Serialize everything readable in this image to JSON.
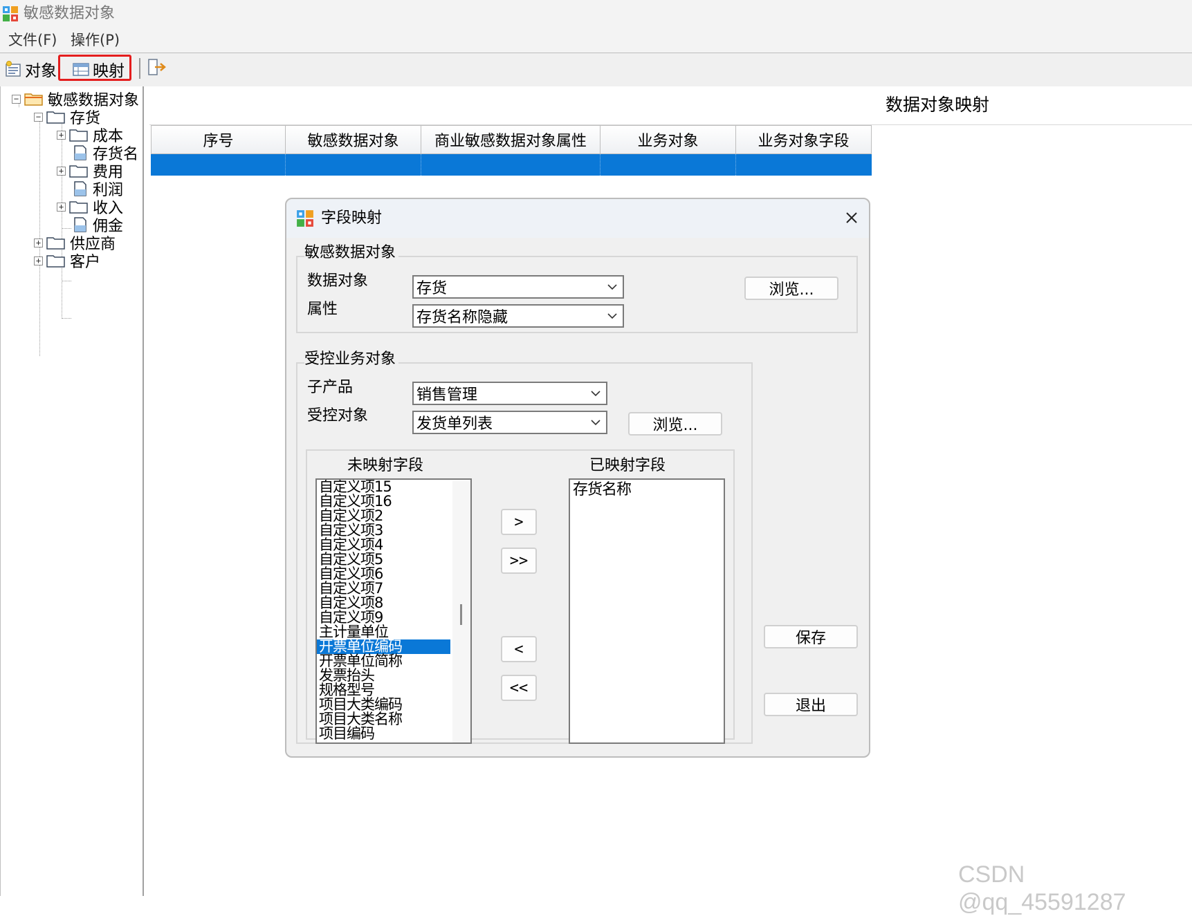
{
  "window": {
    "title": "敏感数据对象"
  },
  "menu": [
    "文件(F)",
    "操作(P)"
  ],
  "toolbar": {
    "object_label": "对象",
    "mapping_label": "映射"
  },
  "tree": {
    "root": "敏感数据对象",
    "inventory": "存货",
    "cost": "成本",
    "inventory_name": "存货名",
    "expense": "费用",
    "profit": "利润",
    "income": "收入",
    "commission": "佣金",
    "supplier": "供应商",
    "customer": "客户"
  },
  "main": {
    "title": "数据对象映射",
    "columns": [
      "序号",
      "敏感数据对象",
      "商业敏感数据对象属性",
      "业务对象",
      "业务对象字段"
    ]
  },
  "dialog": {
    "title": "字段映射",
    "sensitive_group": "敏感数据对象",
    "data_object_label": "数据对象",
    "data_object_value": "存货",
    "attribute_label": "属性",
    "attribute_value": "存货名称隐藏",
    "browse_label": "浏览...",
    "controlled_group": "受控业务对象",
    "sub_product_label": "子产品",
    "sub_product_value": "销售管理",
    "controlled_object_label": "受控对象",
    "controlled_object_value": "发货单列表",
    "unmapped_header": "未映射字段",
    "mapped_header": "已映射字段",
    "unmapped_fields": [
      "自定义项15",
      "自定义项16",
      "自定义项2",
      "自定义项3",
      "自定义项4",
      "自定义项5",
      "自定义项6",
      "自定义项7",
      "自定义项8",
      "自定义项9",
      "主计量单位",
      "开票单位编码",
      "开票单位简称",
      "发票抬头",
      "规格型号",
      "项目大类编码",
      "项目大类名称",
      "项目编码"
    ],
    "selected_unmapped": "开票单位编码",
    "mapped_fields": [
      "存货名称"
    ],
    "move_right": ">",
    "move_all_right": ">>",
    "move_left": "<",
    "move_all_left": "<<",
    "save_label": "保存",
    "exit_label": "退出"
  },
  "watermark": "CSDN @qq_45591287",
  "colors": {
    "selection": "#0a78d7",
    "highlight_border": "#e41d1d"
  }
}
